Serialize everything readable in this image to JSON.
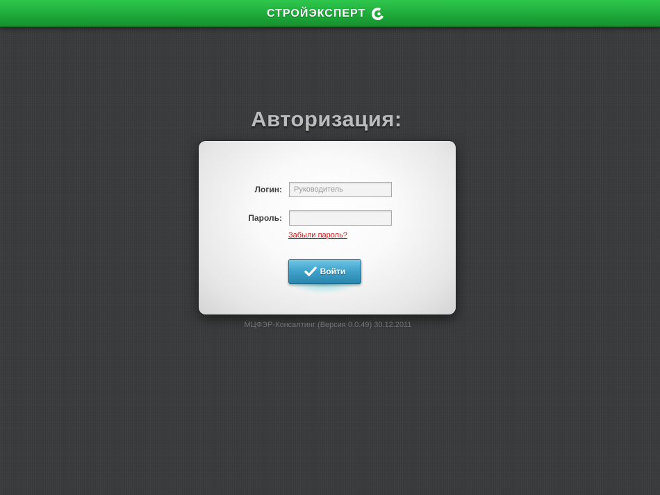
{
  "header": {
    "brand_name": "СТРОЙЭКСПЕРТ",
    "logo_icon": "brand-c-icon",
    "bar_color": "#22b142"
  },
  "page": {
    "title": "Авторизация:"
  },
  "login_form": {
    "login_label": "Логин:",
    "login_value": "",
    "login_placeholder": "Руководитель",
    "password_label": "Пароль:",
    "password_value": "",
    "forgot_link": "Забыли пароль?",
    "submit_label": "Войти",
    "submit_icon": "checkmark-icon",
    "accent_color": "#3fa1c9",
    "link_color": "#cc1414"
  },
  "footer": {
    "version_text": "МЦФЭР-Консалтинг (Версия 0.0.49) 30.12.2011"
  }
}
